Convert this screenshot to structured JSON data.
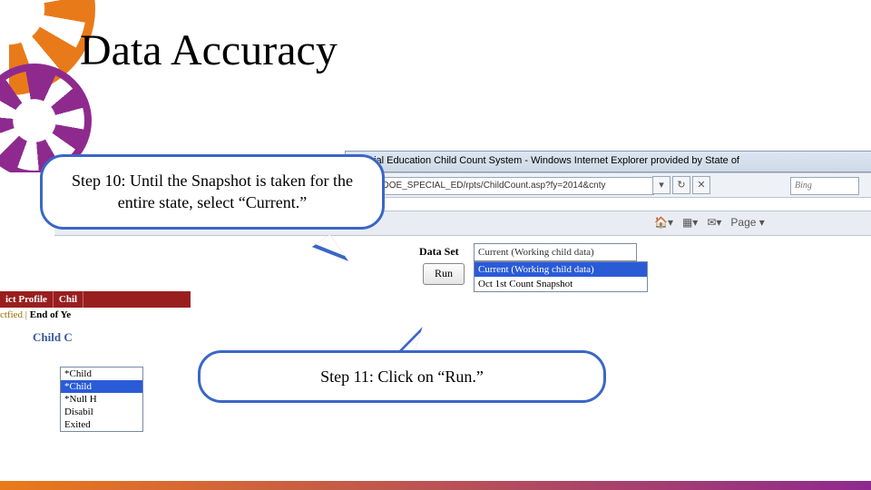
{
  "title": "Data Accuracy",
  "callout1": "Step 10:  Until the Snapshot is taken for the entire state, select “Current.”",
  "callout2": "Step 11:  Click on “Run.”",
  "browser": {
    "window_title": "Special Education Child Count System - Windows Internet Explorer provided by State of",
    "url_fragment": "cal/DOE_SPECIAL_ED/rpts/ChildCount.asp?fy=2014&cnty",
    "search_engine": "Bing",
    "toolbar_page": "Page ▾"
  },
  "tabs": {
    "left": "ict Profile",
    "right": "Chil"
  },
  "subnav": {
    "a": "ctfied",
    "b": "End of Ye"
  },
  "panel_header": "Child C",
  "listbox": {
    "items": [
      "*Child",
      "*Child",
      "*Null H",
      "Disabil",
      "Exited"
    ],
    "selected_index": 1
  },
  "dataset": {
    "label": "Data Set",
    "value": "Current (Working child data)",
    "options": [
      "Current (Working child data)",
      "Oct 1st Count Snapshot"
    ],
    "selected_index": 0
  },
  "run_label": "Run"
}
